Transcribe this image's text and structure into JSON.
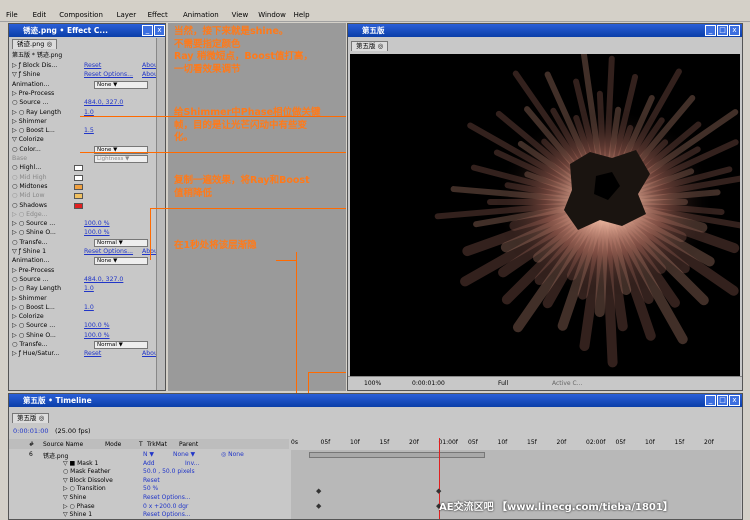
{
  "menu": [
    "File",
    "Edit",
    "Composition",
    "Layer",
    "Effect",
    "Animation",
    "View",
    "Window",
    "Help"
  ],
  "effect_panel": {
    "title": "锈迹.png • Effect C...",
    "tab": "锈迹.png ◎",
    "subtitle": "第五版 * 锈迹.png",
    "rows": [
      {
        "t": "▷ ƒ  Block Dis...",
        "v": "Reset",
        "v2": "About"
      },
      {
        "t": "▽ ƒ  Shine",
        "v": "Reset Options...",
        "v2": "About"
      },
      {
        "t": "   Animation...",
        "dd": "None"
      },
      {
        "t": "  ▷ Pre-Process"
      },
      {
        "t": "    ○ Source ...",
        "v": "484.0, 327.0"
      },
      {
        "t": "  ▷ ○ Ray Length",
        "v": "1.0"
      },
      {
        "t": "  ▷ Shimmer"
      },
      {
        "t": "  ▷ ○ Boost L...",
        "v": "1.5"
      },
      {
        "t": "  ▽ Colorize"
      },
      {
        "t": "    ○ Color...",
        "dd": "None"
      },
      {
        "t": "      Base",
        "dd": "Lightness",
        "grey": true
      },
      {
        "t": "    ○ Highl...",
        "sw": "#ffffff"
      },
      {
        "t": "    ○ Mid High",
        "sw": "#ffffff",
        "grey": true
      },
      {
        "t": "    ○ Midtones",
        "sw": "#f0a040"
      },
      {
        "t": "    ○ Mid Low",
        "sw": "#f0c060",
        "grey": true
      },
      {
        "t": "    ○ Shadows",
        "sw": "#e02020"
      },
      {
        "t": "  ▷ ○ Edge...",
        "grey": true
      },
      {
        "t": "  ▷ ○ Source ...",
        "v": "100.0 %"
      },
      {
        "t": "  ▷ ○ Shine O...",
        "v": "100.0 %"
      },
      {
        "t": "    ○ Transfe...",
        "dd": "Normal"
      },
      {
        "t": "▽ ƒ  Shine 1",
        "v": "Reset Options...",
        "v2": "About"
      },
      {
        "t": "   Animation...",
        "dd": "None"
      },
      {
        "t": "  ▷ Pre-Process"
      },
      {
        "t": "    ○ Source ...",
        "v": "484.0, 327.0"
      },
      {
        "t": "  ▷ ○ Ray Length",
        "v": "1.0"
      },
      {
        "t": "  ▷ Shimmer"
      },
      {
        "t": "  ▷ ○ Boost L...",
        "v": "1.0"
      },
      {
        "t": "  ▷ Colorize"
      },
      {
        "t": "  ▷ ○ Source ...",
        "v": "100.0 %"
      },
      {
        "t": "  ▷ ○ Shine O...",
        "v": "100.0 %"
      },
      {
        "t": "    ○ Transfe...",
        "dd": "Normal"
      },
      {
        "t": "▷ ƒ  Hue/Satur...",
        "v": "Reset",
        "v2": "About"
      }
    ]
  },
  "annotations": [
    "当然，接下来就是shine。\n不需要指定颜色\nRay 稍微短点，Boost值打高，\n一切看效果调节",
    "给Shimmer中Phase相位做关键\n帧，目的是让光芒闪动中有些变\n化。",
    "复制一遍效果，将Ray和Boost\n值稍降低",
    "在1秒处将该层渐隐"
  ],
  "comp": {
    "title": "第五版",
    "tab": "第五版 ◎",
    "zoom": "100%",
    "time": "0:00:01:00",
    "res": "Full",
    "camera": "Active C..."
  },
  "timeline": {
    "title": "第五版 • Timeline",
    "tab": "第五版 ◎",
    "time": "0:00:01:00",
    "fps": "(25.00 fps)",
    "cols": [
      "#",
      "Source Name",
      "Mode",
      "T",
      "TrkMat",
      "Parent"
    ],
    "ruler": [
      "0s",
      "05f",
      "10f",
      "15f",
      "20f",
      "01:00f",
      "05f",
      "10f",
      "15f",
      "20f",
      "02:00f",
      "05f",
      "10f",
      "15f",
      "20f"
    ],
    "layers": [
      {
        "n": "6",
        "name": "锈迹.png",
        "mode": "N ▼",
        "trk": "None ▼",
        "parent": "◎ None"
      },
      {
        "name": "▽ ■ Mask 1",
        "mode": "Add",
        "extra": "Inv..."
      },
      {
        "name": "  ○ Mask Feather",
        "val": "50.0 , 50.0 pixels"
      },
      {
        "name": "▽ Block Dissolve",
        "val": "Reset"
      },
      {
        "name": "  ▷ ○ Transition",
        "val": "50 %"
      },
      {
        "name": "▽ Shine",
        "val": "Reset Options..."
      },
      {
        "name": "  ▷ ○ Phase",
        "val": "0 x +200.0 dgr"
      },
      {
        "name": "▽ Shine 1",
        "val": "Reset Options..."
      }
    ]
  },
  "watermark": "AE交流区吧 【www.linecg.com/tieba/1801】"
}
